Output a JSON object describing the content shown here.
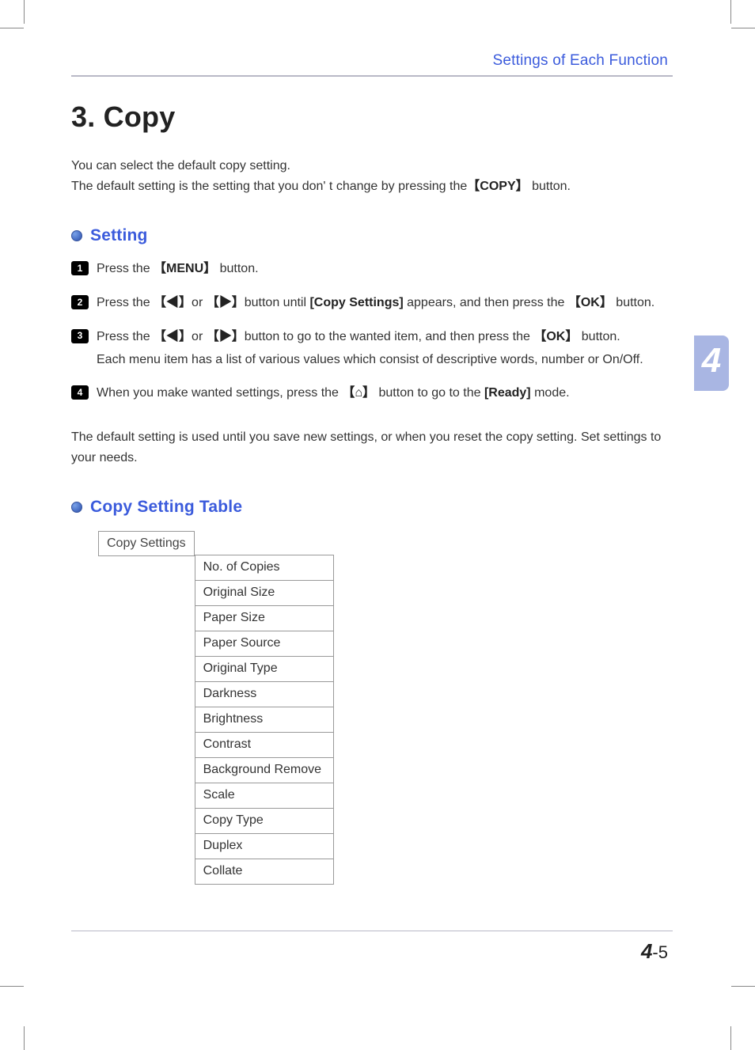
{
  "header": {
    "chapter_name": "Settings of Each Function"
  },
  "side_tab": {
    "number": "4"
  },
  "title": {
    "number": "3",
    "dot": ".",
    "text": "Copy"
  },
  "intro": {
    "line1": "You can select the default copy setting.",
    "line2_pre": "The default setting is the setting that you don' t change by pressing the",
    "line2_btn": "【COPY】",
    "line2_post": " button."
  },
  "subsection_setting": {
    "title": "Setting"
  },
  "steps": [
    {
      "num": "1",
      "text_pre": "Press the ",
      "key1": "【MENU】",
      "text_post": " button."
    },
    {
      "num": "2",
      "text_pre": "Press the ",
      "key1": "【◀】",
      "mid1": "or ",
      "key2": "【▶】",
      "mid2": "button until ",
      "bracket": "[Copy Settings]",
      "mid3": " appears, and then press the ",
      "key3": "【OK】",
      "text_post": " button."
    },
    {
      "num": "3",
      "text_pre": "Press the ",
      "key1": "【◀】",
      "mid1": "or ",
      "key2": "【▶】",
      "mid2": "button to go to the wanted item, and then press the ",
      "key3": "【OK】",
      "text_post": " button.",
      "cont": "Each menu item has a list of various values which consist of descriptive words, number or On/Off."
    },
    {
      "num": "4",
      "text_pre": "When you make wanted settings, press the ",
      "key1": "【⌂】",
      "mid1": " button to go to the ",
      "bracket": "[Ready]",
      "text_post": " mode."
    }
  ],
  "after_steps": {
    "line1": "The default setting is used until you save new settings, or when you reset the copy setting.",
    "line2": "Set settings to your needs."
  },
  "subsection_table": {
    "title": "Copy Setting Table"
  },
  "table": {
    "lead": "Copy Settings",
    "items": [
      "No. of Copies",
      "Original Size",
      "Paper Size",
      "Paper Source",
      "Original Type",
      "Darkness",
      "Brightness",
      "Contrast",
      "Background Remove",
      "Scale",
      "Copy Type",
      "Duplex",
      "Collate"
    ]
  },
  "footer": {
    "chapter": "4",
    "sep": "-",
    "page": "5"
  }
}
